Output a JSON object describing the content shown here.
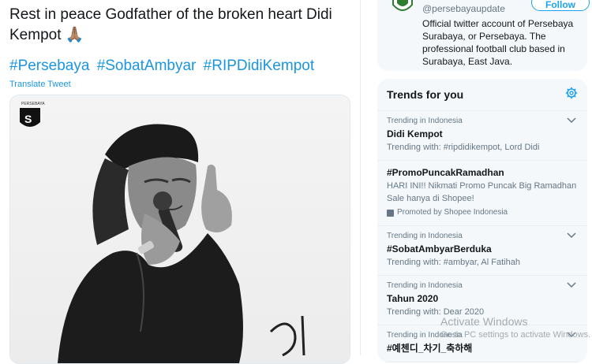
{
  "tweet": {
    "text": "Rest in peace Godfather of the broken heart Didi Kempot",
    "emoji": "🙏🏽",
    "hashtags": [
      "#Persebaya",
      "#SobatAmbyar",
      "#RIPDidiKempot"
    ],
    "translate_label": "Translate Tweet",
    "photo_logo_text": "PERSEBAYA"
  },
  "profile": {
    "handle": "@persebayaupdate",
    "follow_label": "Follow",
    "bio": "Official twitter account of Persebaya Surabaya, or Persebaya. The professional football club based in Surabaya, East Java."
  },
  "trends": {
    "title": "Trends for you",
    "items": [
      {
        "context": "Trending in Indonesia",
        "name": "Didi Kempot",
        "meta": "Trending with: #ripdidikempot, Lord Didi"
      },
      {
        "name": "#PromoPuncakRamadhan",
        "desc": "HARI INI!! Nikmati Promo Puncak Big Ramadhan Sale hanya di Shopee!",
        "promoted": "Promoted by Shopee Indonesia"
      },
      {
        "context": "Trending in Indonesia",
        "name": "#SobatAmbyarBerduka",
        "meta": "Trending with: #ambyar, Al Fatihah"
      },
      {
        "context": "Trending in Indonesia",
        "name": "Tahun 2020",
        "meta": "Trending with: Dear 2020"
      },
      {
        "context": "Trending in Indonesia",
        "name": "#예첸디_차기_축하해"
      }
    ]
  },
  "watermark": {
    "line1": "Activate Windows",
    "line2": "Go to PC settings to activate Windows."
  },
  "colors": {
    "link": "#1b95e0",
    "accent": "#1da1f2",
    "muted": "#657786"
  },
  "icons": {
    "settings": "gear-icon",
    "expand": "chevron-down-icon",
    "promoted": "promoted-icon"
  }
}
